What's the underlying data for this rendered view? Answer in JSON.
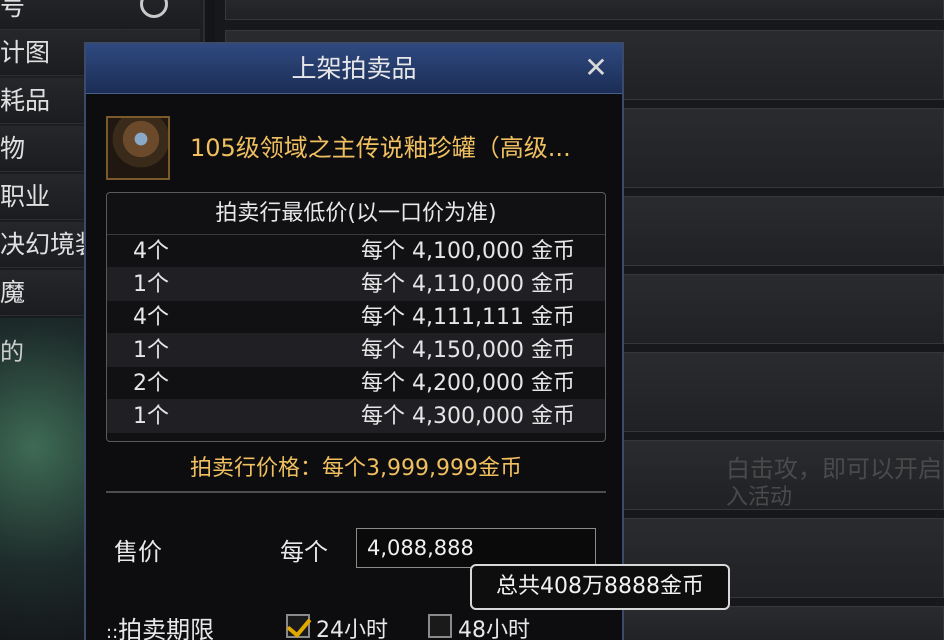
{
  "left_nav": {
    "items": [
      "号",
      "计图",
      "耗品",
      "物",
      "职业",
      "决幻境装备",
      "魔",
      "的"
    ]
  },
  "background": {
    "partial_texts": [
      "白击攻，即可以开启",
      "入活动"
    ]
  },
  "dialog": {
    "title": "上架拍卖品",
    "close_symbol": "✕",
    "item_name": "105级领域之主传说釉珍罐（高级...",
    "price_box_title": "拍卖行最低价(以一口价为准)",
    "price_rows": [
      {
        "qty": "4个",
        "price": "每个  4,100,000  金币"
      },
      {
        "qty": "1个",
        "price": "每个  4,110,000  金币"
      },
      {
        "qty": "4个",
        "price": "每个  4,111,111  金币"
      },
      {
        "qty": "1个",
        "price": "每个  4,150,000  金币"
      },
      {
        "qty": "2个",
        "price": "每个  4,200,000  金币"
      },
      {
        "qty": "1个",
        "price": "每个  4,300,000  金币"
      }
    ],
    "auction_price": "拍卖行价格：每个3,999,999金币",
    "sale_label": "售价",
    "each_label": "每个",
    "price_input_value": "4,088,888",
    "tooltip": "总共408万8888金币",
    "duration_label": "拍卖期限",
    "options": [
      {
        "label": "24小时",
        "checked": true
      },
      {
        "label": "48小时",
        "checked": false
      }
    ]
  }
}
